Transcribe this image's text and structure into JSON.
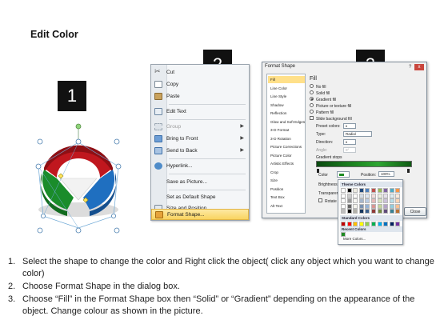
{
  "page": {
    "title": "Edit Color"
  },
  "steps": {
    "one": "1",
    "two": "2",
    "three": "3"
  },
  "wheel": {
    "segment_colors": [
      "#c0171e",
      "#1a8c2a",
      "#1f6fc0"
    ],
    "handle_color": "#8fd47a"
  },
  "context_menu": {
    "items": [
      {
        "label": "Cut",
        "icon": "scissors-icon",
        "disabled": false,
        "submenu": false,
        "highlight": false
      },
      {
        "label": "Copy",
        "icon": "copy-icon",
        "disabled": false,
        "submenu": false,
        "highlight": false
      },
      {
        "label": "Paste",
        "icon": "paste-icon",
        "disabled": false,
        "submenu": false,
        "highlight": false
      },
      {
        "label": "Edit Text",
        "icon": "edit-text-icon",
        "disabled": false,
        "submenu": false,
        "highlight": false
      },
      {
        "label": "Group",
        "icon": "group-icon",
        "disabled": true,
        "submenu": true,
        "highlight": false
      },
      {
        "label": "Bring to Front",
        "icon": "bring-to-front-icon",
        "disabled": false,
        "submenu": true,
        "highlight": false
      },
      {
        "label": "Send to Back",
        "icon": "send-to-back-icon",
        "disabled": false,
        "submenu": true,
        "highlight": false
      },
      {
        "label": "Hyperlink...",
        "icon": "hyperlink-icon",
        "disabled": false,
        "submenu": false,
        "highlight": false
      },
      {
        "label": "Save as Picture...",
        "icon": "",
        "disabled": false,
        "submenu": false,
        "highlight": false
      },
      {
        "label": "Set as Default Shape",
        "icon": "",
        "disabled": false,
        "submenu": false,
        "highlight": false
      },
      {
        "label": "Size and Position...",
        "icon": "size-position-icon",
        "disabled": false,
        "submenu": false,
        "highlight": false
      },
      {
        "label": "Format Shape...",
        "icon": "format-shape-icon",
        "disabled": false,
        "submenu": false,
        "highlight": true
      }
    ]
  },
  "format_dialog": {
    "title": "Format Shape",
    "minimize_glyph": "?",
    "close_glyph": "x",
    "nav": [
      "Fill",
      "Line Color",
      "Line Style",
      "Shadow",
      "Reflection",
      "Glow and Soft Edges",
      "3-D Format",
      "3-D Rotation",
      "Picture Corrections",
      "Picture Color",
      "Artistic Effects",
      "Crop",
      "Size",
      "Position",
      "Text Box",
      "Alt Text"
    ],
    "selected_nav": "Fill",
    "section_title": "Fill",
    "options": [
      {
        "label": "No fill",
        "selected": false
      },
      {
        "label": "Solid fill",
        "selected": false
      },
      {
        "label": "Gradient fill",
        "selected": true
      },
      {
        "label": "Picture or texture fill",
        "selected": false
      },
      {
        "label": "Pattern fill",
        "selected": false
      }
    ],
    "slide_bg_label": "Slide background fill",
    "preset_colors_label": "Preset colors:",
    "type_label": "Type:",
    "type_value": "Radial",
    "direction_label": "Direction:",
    "angle_label": "Angle:",
    "angle_value": "0°",
    "gradient_stops_label": "Gradient stops",
    "color_label": "Color",
    "position_label": "Position:",
    "position_value": "100%",
    "brightness_label": "Brightness",
    "transparency_label": "Transparency",
    "rotate_label": "Rotate with shape",
    "close_label": "Close",
    "gradient_colors": [
      "#0b4a10",
      "#1f8c23",
      "#2ea632",
      "#0f5a13"
    ]
  },
  "palette": {
    "theme_label": "Theme Colors",
    "standard_label": "Standard Colors",
    "recent_label": "Recent Colors",
    "more_label": "More Colors...",
    "theme_top": [
      "#ffffff",
      "#000000",
      "#eeece1",
      "#1f497d",
      "#4f81bd",
      "#c0504d",
      "#9bbb59",
      "#8064a2",
      "#4bacc6",
      "#f79646"
    ],
    "standard": [
      "#c00000",
      "#ff0000",
      "#ffc000",
      "#ffff00",
      "#92d050",
      "#00b050",
      "#00b0f0",
      "#0070c0",
      "#002060",
      "#7030a0"
    ],
    "recent": [
      "#1f8c23"
    ]
  },
  "instructions": [
    {
      "num": "1.",
      "text": "Select the shape to change the color and Right click the object( click any object which you want to change color)"
    },
    {
      "num": "2.",
      "text": "Choose Format Shape in the dialog box."
    },
    {
      "num": "3.",
      "text": "Choose “Fill” in the Format Shape box then “Solid” or “Gradient” depending on the appearance of the object. Change colour as shown in the picture."
    }
  ]
}
